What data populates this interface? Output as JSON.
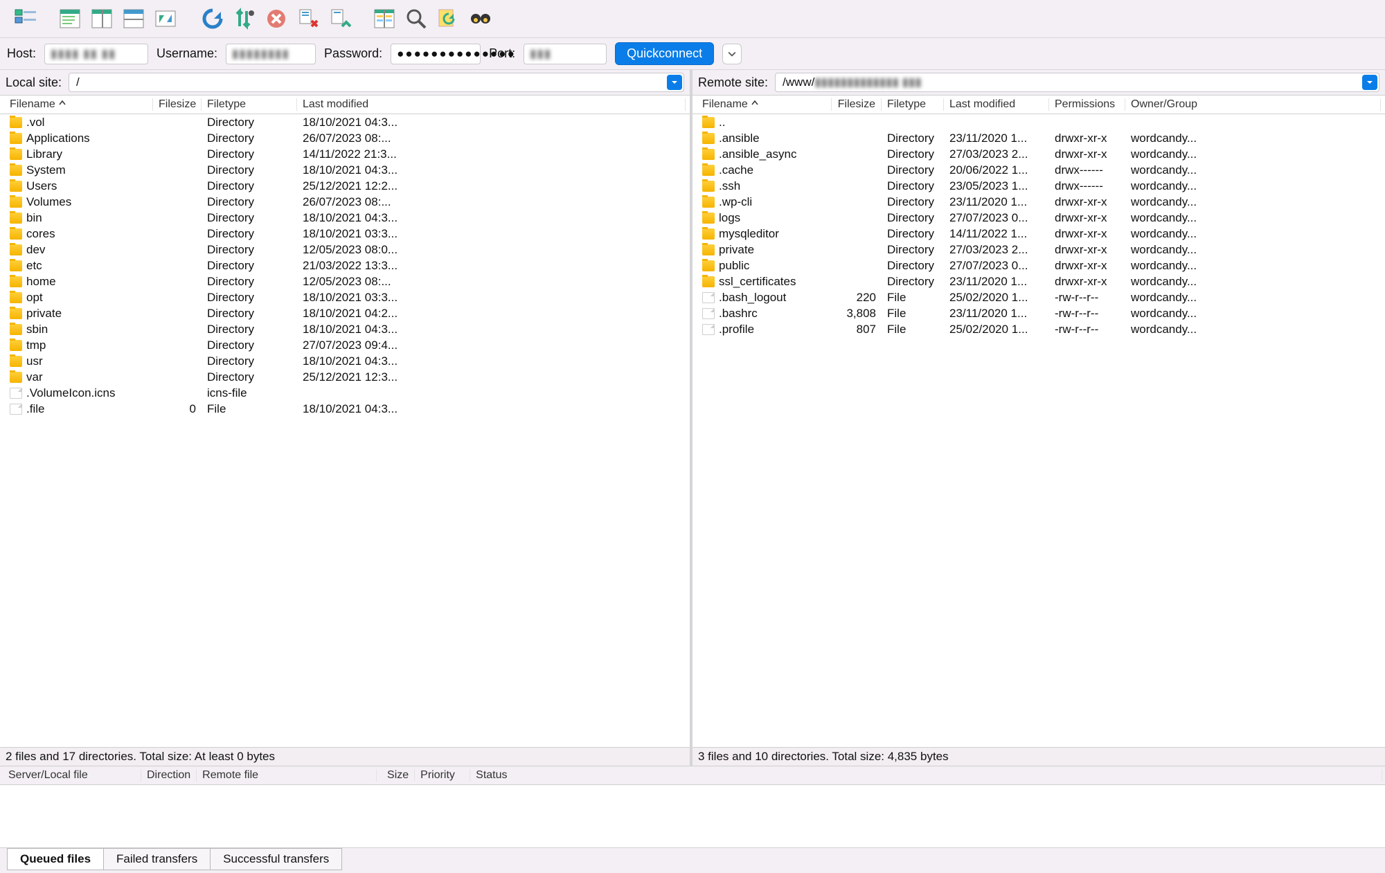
{
  "toolbar_icons": [
    "site-manager-icon",
    "toggle-tree-icon",
    "toggle-queue-icon",
    "toggle-log-icon",
    "sync-browse-icon",
    "refresh-icon",
    "filter-icon",
    "cancel-icon",
    "disconnect-icon",
    "reconnect-icon",
    "compare-icon",
    "search-icon",
    "auto-reconnect-icon",
    "find-icon"
  ],
  "qc": {
    "host_label": "Host:",
    "host_value": "▮▮▮▮ ▮▮ ▮▮",
    "user_label": "Username:",
    "user_value": "▮▮▮▮▮▮▮▮",
    "pass_label": "Password:",
    "pass_value": "●●●●●●●●●●●●●●",
    "port_label": "Port:",
    "port_value": "▮▮▮",
    "button": "Quickconnect"
  },
  "local": {
    "site_label": "Local site:",
    "path": "/",
    "cols": {
      "name": "Filename",
      "size": "Filesize",
      "type": "Filetype",
      "mod": "Last modified"
    },
    "rows": [
      {
        "icon": "folder",
        "name": ".vol",
        "size": "",
        "type": "Directory",
        "mod": "18/10/2021 04:3..."
      },
      {
        "icon": "folder",
        "name": "Applications",
        "size": "",
        "type": "Directory",
        "mod": "26/07/2023 08:..."
      },
      {
        "icon": "folder",
        "name": "Library",
        "size": "",
        "type": "Directory",
        "mod": "14/11/2022 21:3..."
      },
      {
        "icon": "folder",
        "name": "System",
        "size": "",
        "type": "Directory",
        "mod": "18/10/2021 04:3..."
      },
      {
        "icon": "folder",
        "name": "Users",
        "size": "",
        "type": "Directory",
        "mod": "25/12/2021 12:2..."
      },
      {
        "icon": "folder",
        "name": "Volumes",
        "size": "",
        "type": "Directory",
        "mod": "26/07/2023 08:..."
      },
      {
        "icon": "folder",
        "name": "bin",
        "size": "",
        "type": "Directory",
        "mod": "18/10/2021 04:3..."
      },
      {
        "icon": "folder",
        "name": "cores",
        "size": "",
        "type": "Directory",
        "mod": "18/10/2021 03:3..."
      },
      {
        "icon": "folder",
        "name": "dev",
        "size": "",
        "type": "Directory",
        "mod": "12/05/2023 08:0..."
      },
      {
        "icon": "folder",
        "name": "etc",
        "size": "",
        "type": "Directory",
        "mod": "21/03/2022 13:3..."
      },
      {
        "icon": "folder",
        "name": "home",
        "size": "",
        "type": "Directory",
        "mod": "12/05/2023 08:..."
      },
      {
        "icon": "folder",
        "name": "opt",
        "size": "",
        "type": "Directory",
        "mod": "18/10/2021 03:3..."
      },
      {
        "icon": "folder",
        "name": "private",
        "size": "",
        "type": "Directory",
        "mod": "18/10/2021 04:2..."
      },
      {
        "icon": "folder",
        "name": "sbin",
        "size": "",
        "type": "Directory",
        "mod": "18/10/2021 04:3..."
      },
      {
        "icon": "folder",
        "name": "tmp",
        "size": "",
        "type": "Directory",
        "mod": "27/07/2023 09:4..."
      },
      {
        "icon": "folder",
        "name": "usr",
        "size": "",
        "type": "Directory",
        "mod": "18/10/2021 04:3..."
      },
      {
        "icon": "folder",
        "name": "var",
        "size": "",
        "type": "Directory",
        "mod": "25/12/2021 12:3..."
      },
      {
        "icon": "file",
        "name": ".VolumeIcon.icns",
        "size": "",
        "type": "icns-file",
        "mod": ""
      },
      {
        "icon": "file",
        "name": ".file",
        "size": "0",
        "type": "File",
        "mod": "18/10/2021 04:3..."
      }
    ],
    "status": "2 files and 17 directories. Total size: At least 0 bytes"
  },
  "remote": {
    "site_label": "Remote site:",
    "path_prefix": "/www/",
    "path_blur": "▮▮▮▮▮▮▮▮▮▮▮▮▮ ▮▮▮",
    "cols": {
      "name": "Filename",
      "size": "Filesize",
      "type": "Filetype",
      "mod": "Last modified",
      "perm": "Permissions",
      "own": "Owner/Group"
    },
    "rows": [
      {
        "icon": "folder",
        "name": "..",
        "size": "",
        "type": "",
        "mod": "",
        "perm": "",
        "own": ""
      },
      {
        "icon": "folder",
        "name": ".ansible",
        "size": "",
        "type": "Directory",
        "mod": "23/11/2020 1...",
        "perm": "drwxr-xr-x",
        "own": "wordcandy..."
      },
      {
        "icon": "folder",
        "name": ".ansible_async",
        "size": "",
        "type": "Directory",
        "mod": "27/03/2023 2...",
        "perm": "drwxr-xr-x",
        "own": "wordcandy..."
      },
      {
        "icon": "folder",
        "name": ".cache",
        "size": "",
        "type": "Directory",
        "mod": "20/06/2022 1...",
        "perm": "drwx------",
        "own": "wordcandy..."
      },
      {
        "icon": "folder",
        "name": ".ssh",
        "size": "",
        "type": "Directory",
        "mod": "23/05/2023 1...",
        "perm": "drwx------",
        "own": "wordcandy..."
      },
      {
        "icon": "folder",
        "name": ".wp-cli",
        "size": "",
        "type": "Directory",
        "mod": "23/11/2020 1...",
        "perm": "drwxr-xr-x",
        "own": "wordcandy..."
      },
      {
        "icon": "folder",
        "name": "logs",
        "size": "",
        "type": "Directory",
        "mod": "27/07/2023 0...",
        "perm": "drwxr-xr-x",
        "own": "wordcandy..."
      },
      {
        "icon": "folder",
        "name": "mysqleditor",
        "size": "",
        "type": "Directory",
        "mod": "14/11/2022 1...",
        "perm": "drwxr-xr-x",
        "own": "wordcandy..."
      },
      {
        "icon": "folder",
        "name": "private",
        "size": "",
        "type": "Directory",
        "mod": "27/03/2023 2...",
        "perm": "drwxr-xr-x",
        "own": "wordcandy..."
      },
      {
        "icon": "folder",
        "name": "public",
        "size": "",
        "type": "Directory",
        "mod": "27/07/2023 0...",
        "perm": "drwxr-xr-x",
        "own": "wordcandy..."
      },
      {
        "icon": "folder",
        "name": "ssl_certificates",
        "size": "",
        "type": "Directory",
        "mod": "23/11/2020 1...",
        "perm": "drwxr-xr-x",
        "own": "wordcandy..."
      },
      {
        "icon": "file",
        "name": ".bash_logout",
        "size": "220",
        "type": "File",
        "mod": "25/02/2020 1...",
        "perm": "-rw-r--r--",
        "own": "wordcandy..."
      },
      {
        "icon": "file",
        "name": ".bashrc",
        "size": "3,808",
        "type": "File",
        "mod": "23/11/2020 1...",
        "perm": "-rw-r--r--",
        "own": "wordcandy..."
      },
      {
        "icon": "file",
        "name": ".profile",
        "size": "807",
        "type": "File",
        "mod": "25/02/2020 1...",
        "perm": "-rw-r--r--",
        "own": "wordcandy..."
      }
    ],
    "status": "3 files and 10 directories. Total size: 4,835 bytes"
  },
  "queue": {
    "cols": {
      "sl": "Server/Local file",
      "dir": "Direction",
      "rem": "Remote file",
      "size": "Size",
      "pri": "Priority",
      "stat": "Status"
    }
  },
  "tabs": {
    "queued": "Queued files",
    "failed": "Failed transfers",
    "success": "Successful transfers"
  }
}
